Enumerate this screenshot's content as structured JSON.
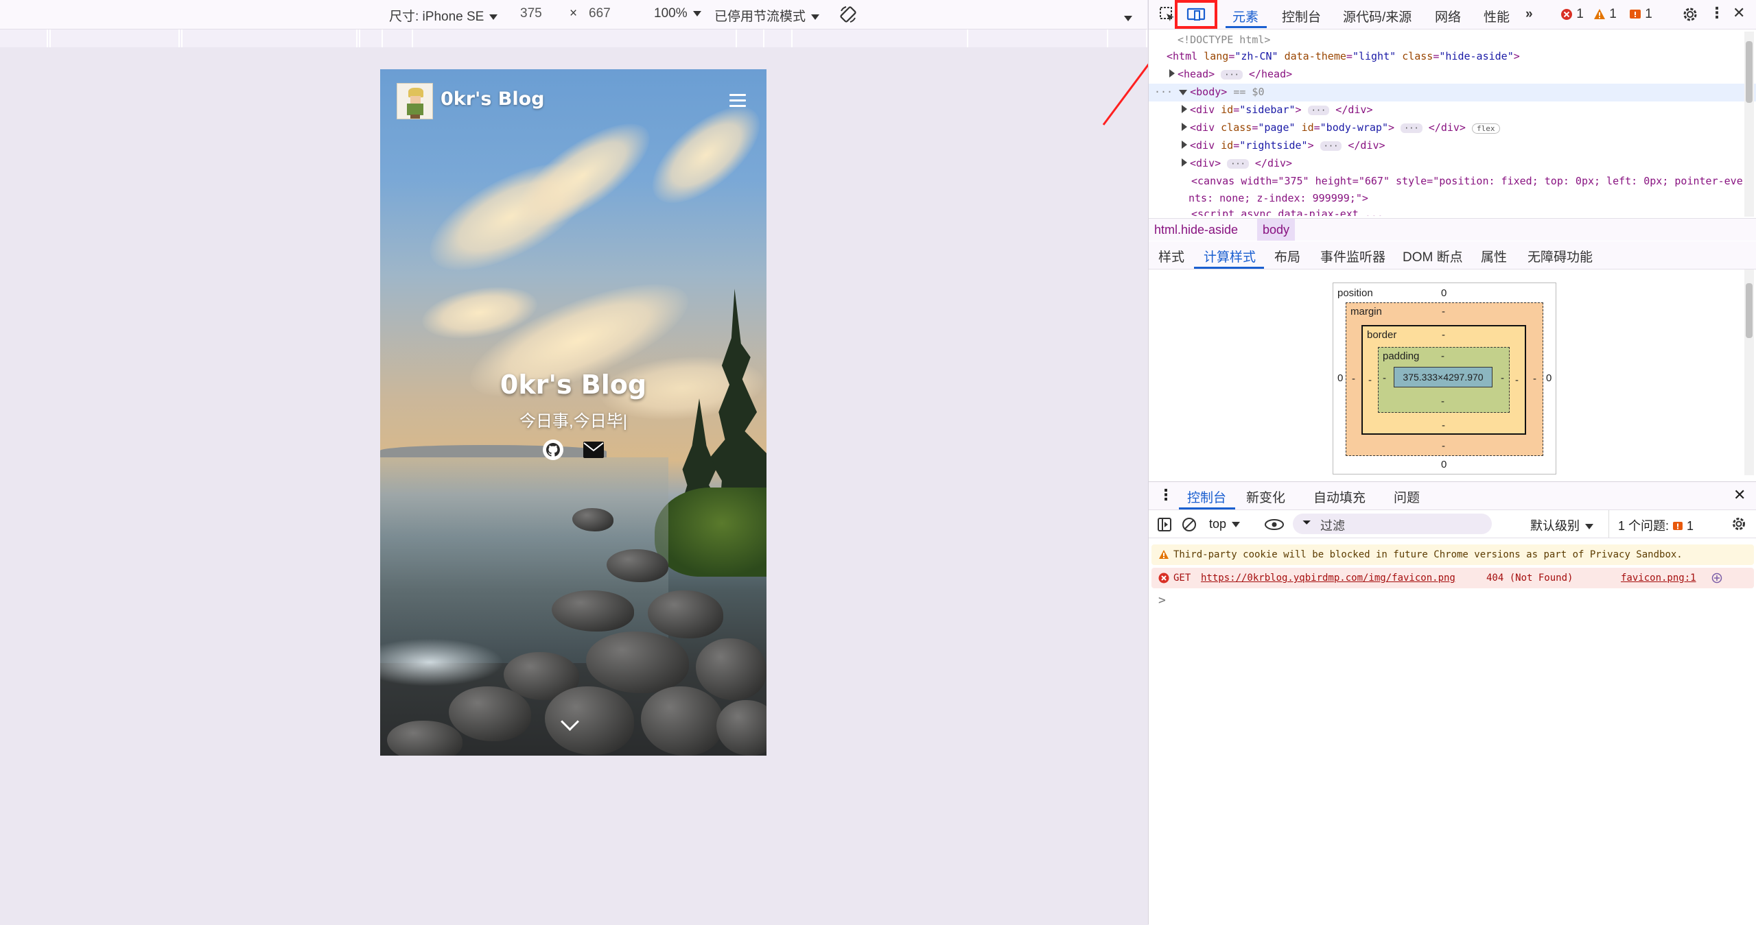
{
  "device_toolbar": {
    "dimensions_label": "尺寸: iPhone SE",
    "width": "375",
    "times": "×",
    "height": "667",
    "zoom": "100%",
    "throttle": "已停用节流模式",
    "more_icon": "triangle-down-icon"
  },
  "site": {
    "brand": "0kr's Blog",
    "title": "0kr's Blog",
    "subtitle": "今日事,今日毕|"
  },
  "devtools": {
    "tabs": [
      "元素",
      "控制台",
      "源代码/来源",
      "网络",
      "性能"
    ],
    "active_tab": "元素",
    "error_count": "1",
    "warning_count": "1",
    "issue_count": "1",
    "colors": {
      "accent": "#1a5fd0",
      "highlight": "#ff1f1f",
      "error": "#d93025",
      "warning": "#e37400"
    },
    "dom": {
      "doctype": "DOCTYPE html>",
      "html_open_tag": "html",
      "html_attr1": "lang",
      "html_val1": "\"zh-CN\"",
      "html_attr2": "data-theme",
      "html_val2": "\"light\"",
      "html_attr3": "class",
      "html_val3": "\"hide-aside\"",
      "head": "head",
      "body": "body",
      "body_ref": "== $0",
      "sidebar_id": "\"sidebar\"",
      "bodywrap_class": "\"page\"",
      "bodywrap_id": "\"body-wrap\"",
      "flex_badge": "flex",
      "rightside_id": "\"rightside\"",
      "canvas_line1": "<canvas width=\"375\" height=\"667\" style=\"position: fixed; top: 0px; left: 0px; pointer-eve",
      "canvas_line2": "nts: none; z-index: 999999;\">",
      "script_line": "<script async data-pjax-ext ..."
    },
    "breadcrumbs": [
      "html.hide-aside",
      "body"
    ],
    "subtabs": [
      "样式",
      "计算样式",
      "布局",
      "事件监听器",
      "DOM 断点",
      "属性",
      "无障碍功能"
    ],
    "active_subtab": "计算样式",
    "box_model": {
      "position_label": "position",
      "position_value": "0",
      "margin_label": "margin",
      "border_label": "border",
      "padding_label": "padding",
      "content": "375.333×4297.970",
      "dash": "-",
      "left": "0",
      "right": "0",
      "bottom": "0"
    },
    "drawer": {
      "tabs": [
        "控制台",
        "新变化",
        "自动填充",
        "问题"
      ],
      "active_tab": "控制台",
      "context": "top",
      "filter_placeholder": "过滤",
      "level": "默认级别",
      "issues_label": "1 个问题:",
      "issues_count": "1",
      "warning_message": "Third-party cookie will be blocked in future Chrome versions as part of Privacy Sandbox.",
      "error_method": "GET",
      "error_url": "https://0krblog.yqbirdmp.com/img/favicon.png",
      "error_status": "404 (Not Found)",
      "error_source": "favicon.png:1",
      "prompt": ">"
    }
  }
}
